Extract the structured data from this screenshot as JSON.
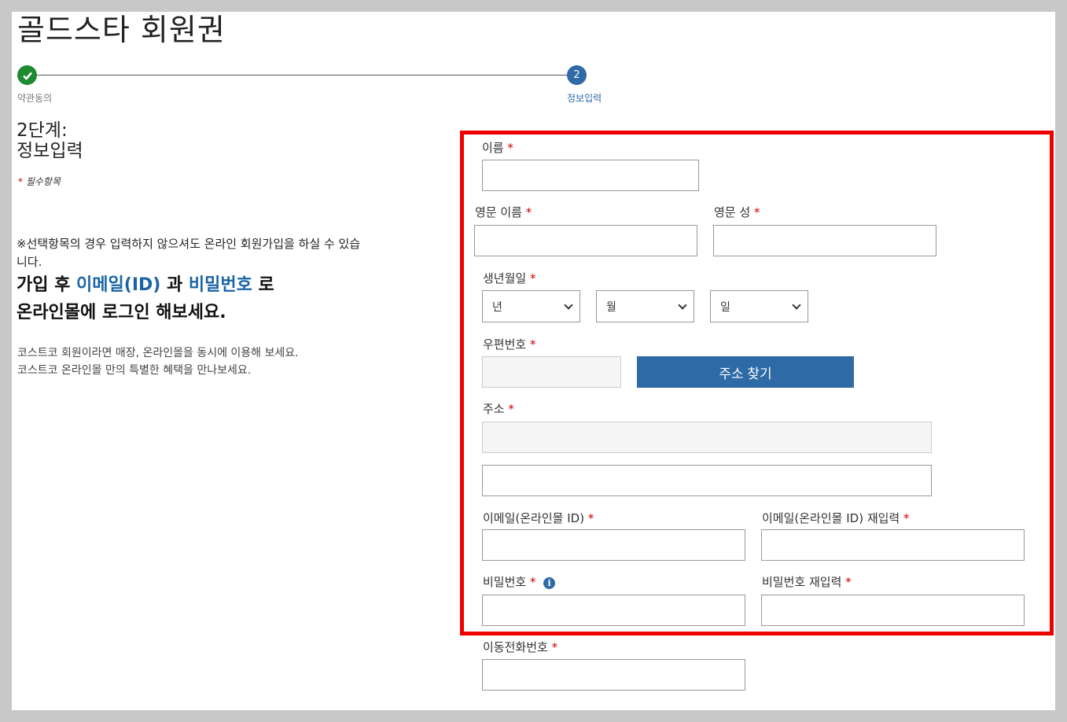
{
  "page": {
    "title": "골드스타 회원권"
  },
  "stepper": {
    "steps": [
      {
        "label": "약관동의",
        "status": "completed",
        "icon": "check-icon"
      },
      {
        "label": "정보입력",
        "status": "current",
        "number": "2"
      }
    ]
  },
  "intro": {
    "stage_line1": "2단계:",
    "stage_line2": "정보입력",
    "required_mark": "*",
    "required_note": "필수항목",
    "optional_note": "※선택항목의 경우 입력하지 않으셔도 온라인 회원가입을 하실 수 있습니다.",
    "promo_part1": "가입 후 ",
    "promo_email": "이메일(ID)",
    "promo_part2": " 과 ",
    "promo_password": "비밀번호",
    "promo_part3": " 로",
    "promo_line2": "온라인몰에 로그인 해보세요.",
    "info_line1": "코스트코 회원이라면 매장, 온라인몰을 동시에 이용해 보세요.",
    "info_line2": "코스트코 온라인몰 만의 특별한 혜택을 만나보세요."
  },
  "form": {
    "required_mark": "*",
    "name_label": "이름",
    "english_first_name_label": "영문 이름",
    "english_last_name_label": "영문 성",
    "birthdate_label": "생년월일",
    "year_value": "년",
    "month_value": "월",
    "day_value": "일",
    "postal_code_label": "우편번호",
    "find_address_button": "주소 찾기",
    "address_label": "주소",
    "email_label": "이메일(온라인몰 ID)",
    "email_confirm_label": "이메일(온라인몰 ID) 재입력",
    "password_label": "비밀번호",
    "password_info_icon": "i",
    "password_confirm_label": "비밀번호 재입력",
    "mobile_label": "이동전화번호"
  },
  "colors": {
    "accent": "#2d6aa6",
    "success": "#1f8a2f",
    "required": "#cc0000",
    "highlight": "#ee0000"
  }
}
